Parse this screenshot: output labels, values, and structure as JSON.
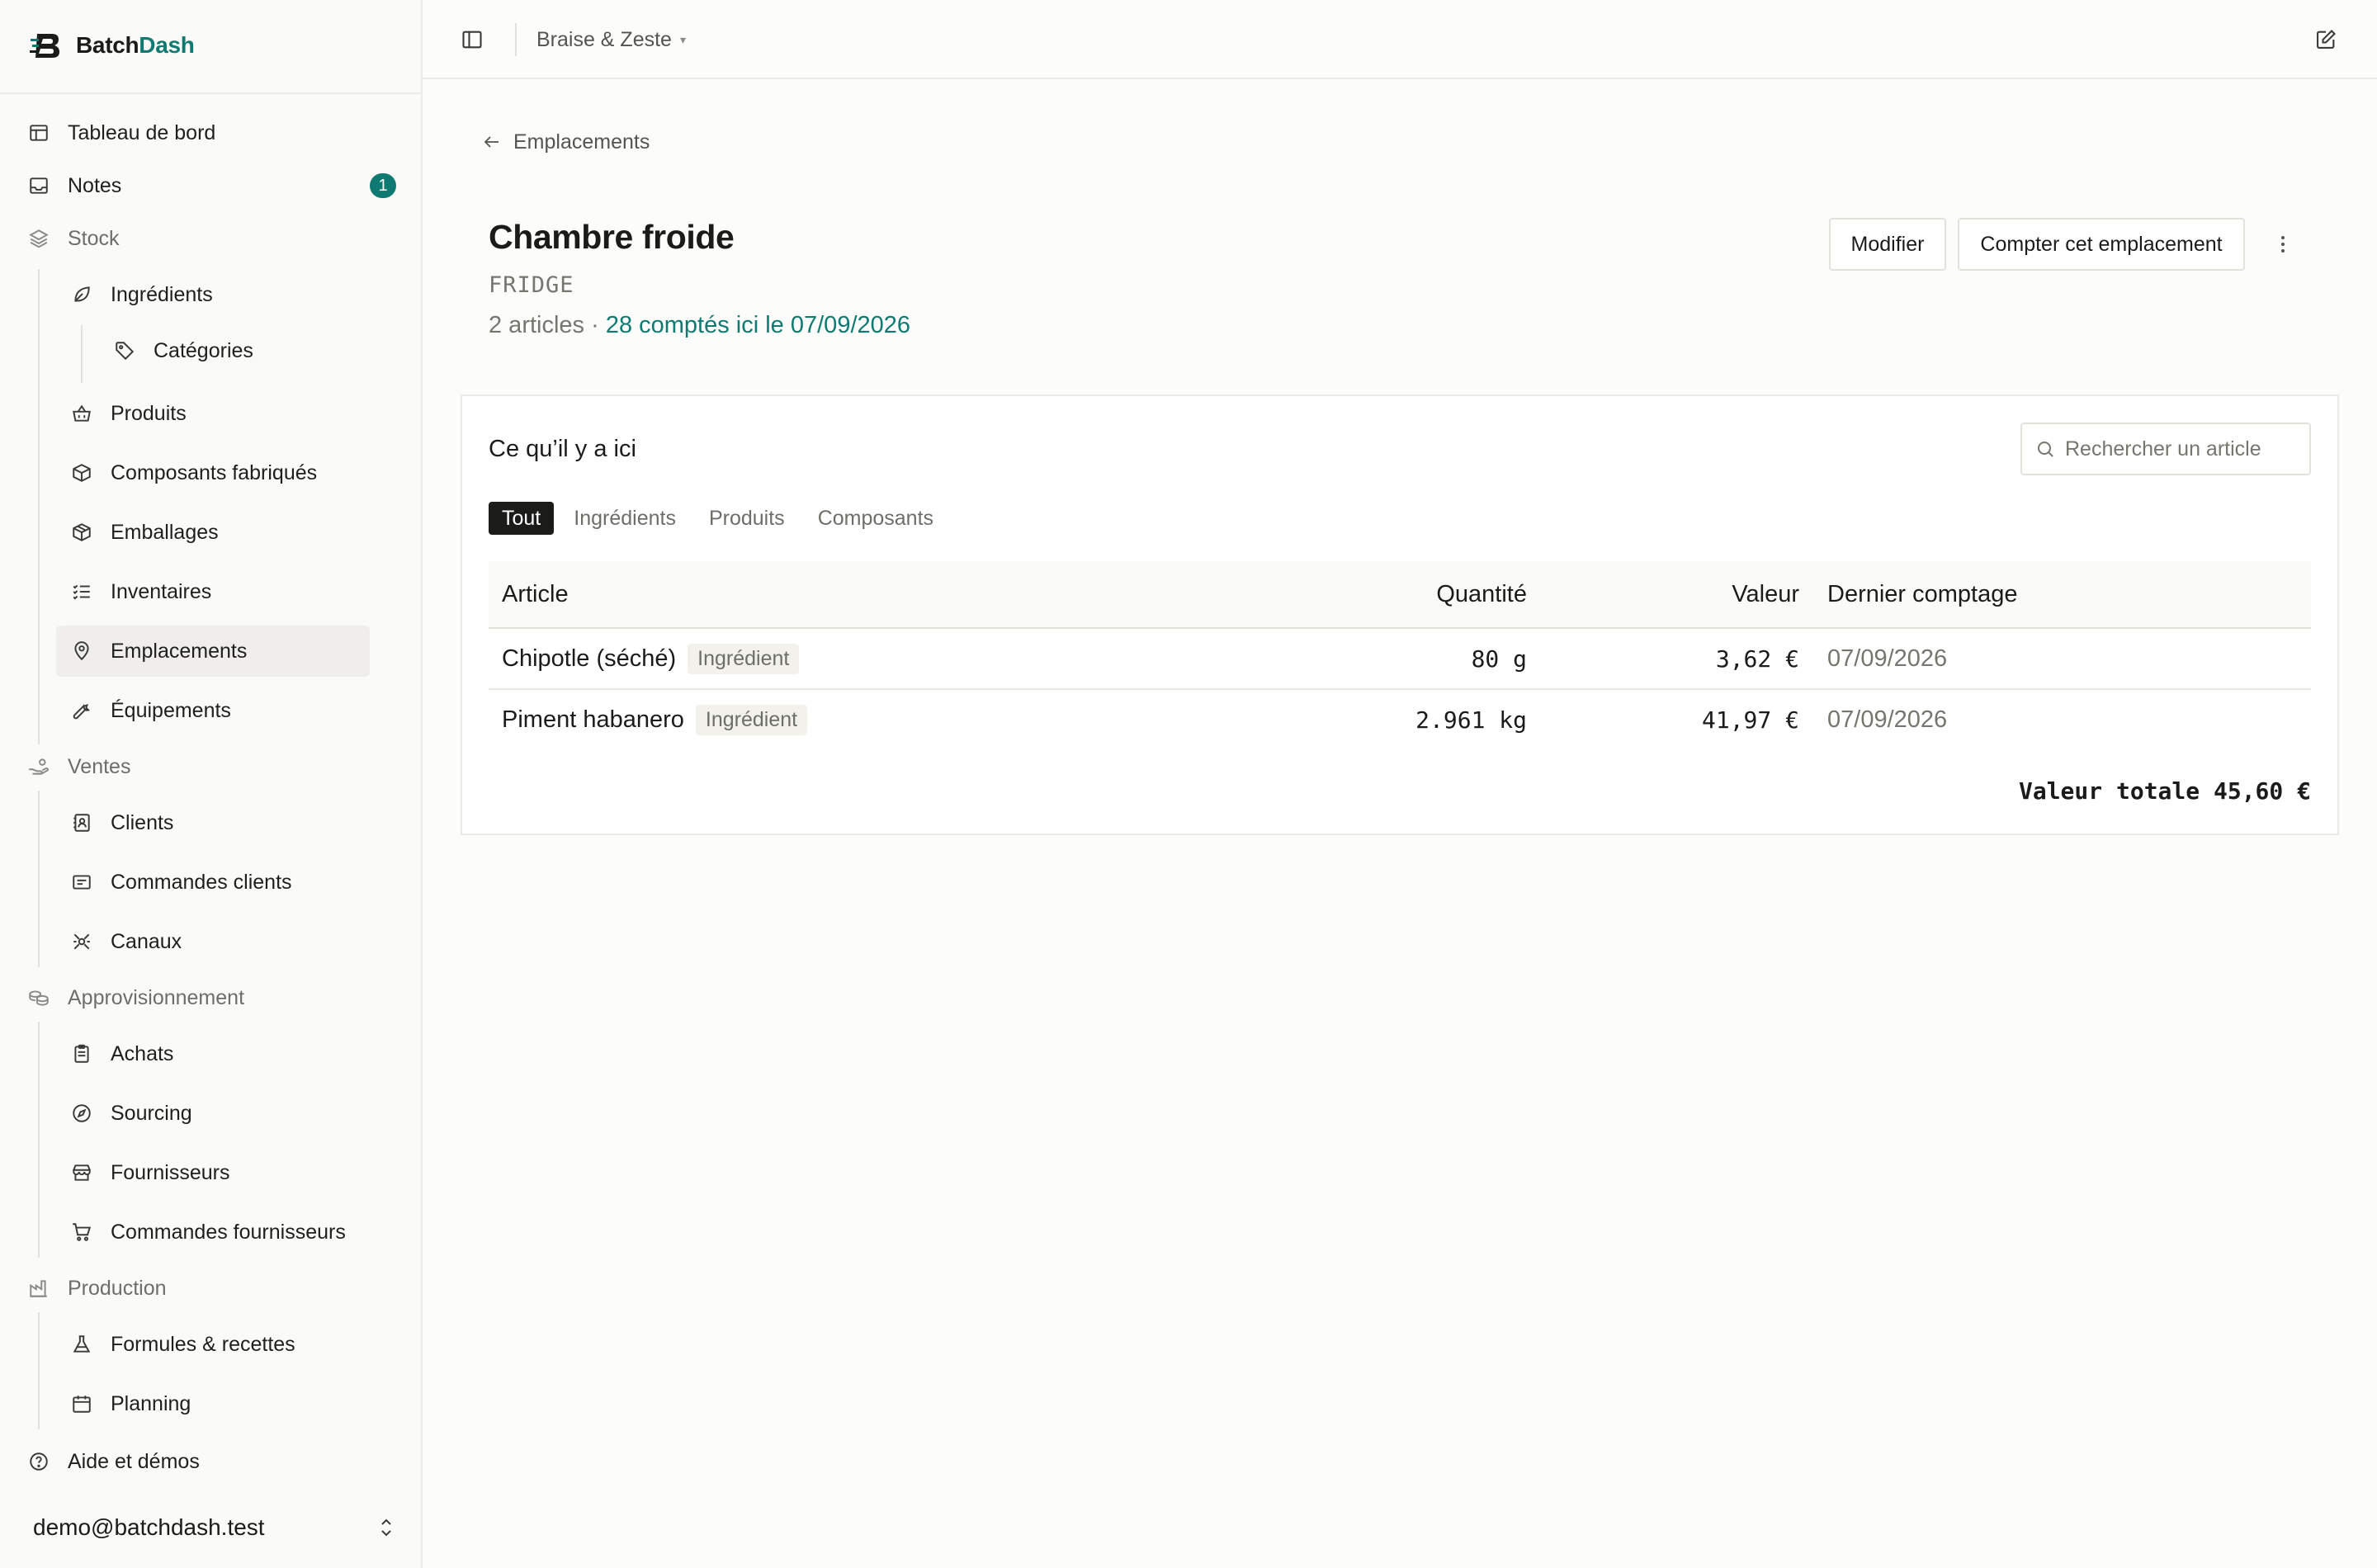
{
  "brand": {
    "name_prefix": "Batch",
    "name_accent": "Dash",
    "accent_color": "#0f7a72"
  },
  "sidebar": {
    "items": [
      {
        "label": "Tableau de bord",
        "icon": "layout-icon"
      },
      {
        "label": "Notes",
        "icon": "inbox-icon",
        "badge": "1"
      },
      {
        "label": "Stock",
        "icon": "layers-icon",
        "section": true
      },
      {
        "label": "Ingrédients",
        "icon": "leaf-icon"
      },
      {
        "label": "Catégories",
        "icon": "tag-icon"
      },
      {
        "label": "Produits",
        "icon": "basket-icon"
      },
      {
        "label": "Composants fabriqués",
        "icon": "box-icon"
      },
      {
        "label": "Emballages",
        "icon": "package-icon"
      },
      {
        "label": "Inventaires",
        "icon": "checklist-icon"
      },
      {
        "label": "Emplacements",
        "icon": "map-pin-icon",
        "active": true
      },
      {
        "label": "Équipements",
        "icon": "wrench-icon"
      },
      {
        "label": "Ventes",
        "icon": "hand-coins-icon",
        "section": true
      },
      {
        "label": "Clients",
        "icon": "contact-book-icon"
      },
      {
        "label": "Commandes clients",
        "icon": "receipt-icon"
      },
      {
        "label": "Canaux",
        "icon": "satellite-icon"
      },
      {
        "label": "Approvisionnement",
        "icon": "coins-icon",
        "section": true
      },
      {
        "label": "Achats",
        "icon": "clipboard-icon"
      },
      {
        "label": "Sourcing",
        "icon": "compass-icon"
      },
      {
        "label": "Fournisseurs",
        "icon": "store-icon"
      },
      {
        "label": "Commandes fournisseurs",
        "icon": "cart-icon"
      },
      {
        "label": "Production",
        "icon": "factory-icon",
        "section": true
      },
      {
        "label": "Formules & recettes",
        "icon": "flask-icon"
      },
      {
        "label": "Planning",
        "icon": "calendar-icon"
      },
      {
        "label": "Aide et démos",
        "icon": "help-circle-icon"
      }
    ],
    "user_email": "demo@batchdash.test"
  },
  "topbar": {
    "workspace": "Braise & Zeste",
    "caret": "▾"
  },
  "page": {
    "back_label": "Emplacements",
    "title": "Chambre froide",
    "code": "FRIDGE",
    "meta_count": "2 articles · ",
    "meta_link": "28 comptés ici le 07/09/2026",
    "edit_button": "Modifier",
    "count_button": "Compter cet emplacement"
  },
  "card": {
    "title": "Ce qu’il y a ici",
    "search_placeholder": "Rechercher un article",
    "tabs": [
      "Tout",
      "Ingrédients",
      "Produits",
      "Composants"
    ],
    "active_tab": 0,
    "columns": [
      "Article",
      "Quantité",
      "Valeur",
      "Dernier comptage"
    ],
    "rows": [
      {
        "article": "Chipotle (séché)",
        "type": "Ingrédient",
        "quantity": "80 g",
        "value": "3,62 €",
        "last_count": "07/09/2026"
      },
      {
        "article": "Piment habanero",
        "type": "Ingrédient",
        "quantity": "2.961 kg",
        "value": "41,97 €",
        "last_count": "07/09/2026"
      }
    ],
    "total": "Valeur totale 45,60 €"
  }
}
